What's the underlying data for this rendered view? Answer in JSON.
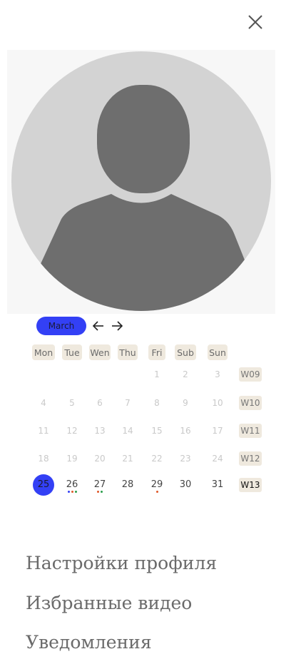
{
  "calendar": {
    "month": "March",
    "weekdays": [
      "Mon",
      "Tue",
      "Wen",
      "Thu",
      "Fri",
      "Sub",
      "Sun"
    ],
    "weeks": [
      {
        "label": "W09",
        "days": [
          "",
          "",
          "",
          "",
          "1",
          "2",
          "3"
        ]
      },
      {
        "label": "W10",
        "days": [
          "4",
          "5",
          "6",
          "7",
          "8",
          "9",
          "10"
        ]
      },
      {
        "label": "W11",
        "days": [
          "11",
          "12",
          "13",
          "14",
          "15",
          "16",
          "17"
        ]
      },
      {
        "label": "W12",
        "days": [
          "18",
          "19",
          "20",
          "21",
          "22",
          "23",
          "24"
        ]
      },
      {
        "label": "W13",
        "days": [
          "25",
          "26",
          "27",
          "28",
          "29",
          "30",
          "31"
        ]
      }
    ],
    "today": "25",
    "event_dot_colors": {
      "26": [
        "#3340f5",
        "#e05a2a",
        "#2a9d4a"
      ],
      "27": [
        "#e05a2a",
        "#2a9d4a"
      ],
      "29": [
        "#e05a2a"
      ]
    },
    "accent_color": "#3340f5"
  },
  "menu": {
    "items": [
      {
        "id": "profile-settings",
        "label": "Настройки профиля"
      },
      {
        "id": "favorite-videos",
        "label": "Избранные видео"
      },
      {
        "id": "notifications",
        "label": "Уведомления"
      }
    ]
  },
  "icons": {
    "close": "close-icon",
    "prev": "arrow-left-icon",
    "next": "arrow-right-icon",
    "avatar": "user-placeholder-icon"
  }
}
